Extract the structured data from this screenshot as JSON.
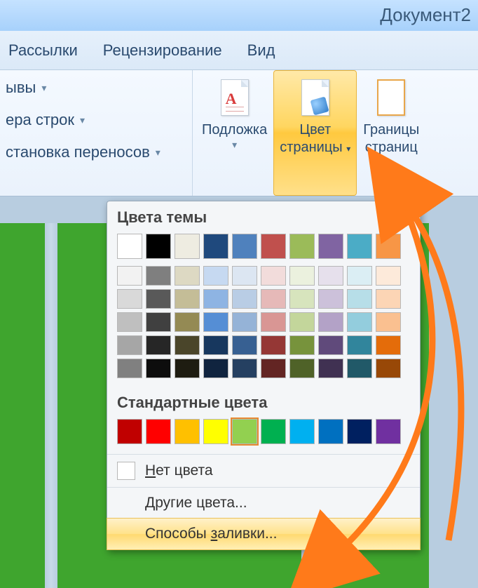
{
  "title": "Документ2",
  "tabs": [
    "Рассылки",
    "Рецензирование",
    "Вид"
  ],
  "ribbon_left": {
    "btn0": "ывы",
    "btn1": "ера строк",
    "btn2": "становка переносов"
  },
  "ribbon_big": {
    "watermark": "Подложка",
    "page_color": {
      "l1": "Цвет",
      "l2": "страницы"
    },
    "borders": {
      "l1": "Границы",
      "l2": "страниц"
    }
  },
  "popup": {
    "theme_title": "Цвета темы",
    "std_title": "Стандартные цвета",
    "no_color": "Нет цвета",
    "more_colors": "Другие цвета...",
    "fill_effects": "Способы заливки...",
    "theme_row": [
      "#ffffff",
      "#000000",
      "#eeece1",
      "#1f497d",
      "#4f81bd",
      "#c0504d",
      "#9bbb59",
      "#8064a2",
      "#4bacc6",
      "#f79646"
    ],
    "shades": [
      [
        "#f2f2f2",
        "#7f7f7f",
        "#ddd9c3",
        "#c6d9f1",
        "#dce6f2",
        "#f2dcdb",
        "#ebf1de",
        "#e6e0ec",
        "#dbeef4",
        "#fdeada"
      ],
      [
        "#d9d9d9",
        "#595959",
        "#c4bd97",
        "#8eb4e3",
        "#b9cde5",
        "#e6b9b8",
        "#d7e4bd",
        "#ccc1da",
        "#b7dee8",
        "#fcd5b5"
      ],
      [
        "#bfbfbf",
        "#404040",
        "#948a54",
        "#558ed5",
        "#95b3d7",
        "#d99694",
        "#c3d69b",
        "#b3a2c7",
        "#93cddd",
        "#fac090"
      ],
      [
        "#a6a6a6",
        "#262626",
        "#4a452a",
        "#17375e",
        "#376092",
        "#953735",
        "#77933c",
        "#604a7b",
        "#31859c",
        "#e46c0a"
      ],
      [
        "#808080",
        "#0d0d0d",
        "#1e1c11",
        "#10243f",
        "#254061",
        "#632523",
        "#4f6228",
        "#403152",
        "#215968",
        "#984807"
      ]
    ],
    "standard": [
      "#c00000",
      "#ff0000",
      "#ffc000",
      "#ffff00",
      "#92d050",
      "#00b050",
      "#00b0f0",
      "#0070c0",
      "#002060",
      "#7030a0"
    ],
    "selected_std_index": 4
  }
}
